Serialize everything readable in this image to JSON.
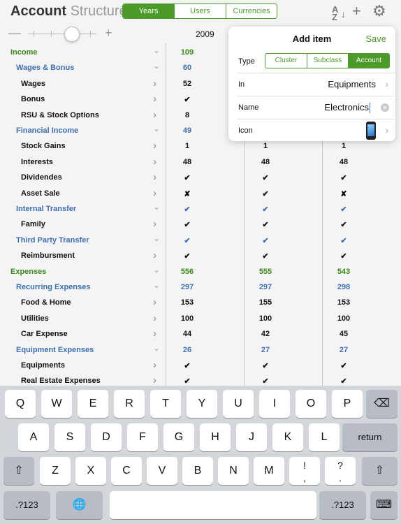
{
  "header": {
    "title_bold": "Account",
    "title_light": "Structure",
    "tabs": [
      "Years",
      "Users",
      "Currencies"
    ],
    "active_tab": "Years",
    "sort_icon": "sort-az-icon",
    "add_icon": "plus-icon",
    "settings_icon": "gear-icon"
  },
  "zoom": {
    "minus": "—",
    "plus": "+",
    "year": "2009"
  },
  "rows": [
    {
      "label": "Income",
      "level": "cat",
      "expand": "down",
      "v": [
        "109",
        "",
        ""
      ]
    },
    {
      "label": "Wages & Bonus",
      "level": "sub",
      "expand": "down",
      "v": [
        "60",
        "",
        ""
      ]
    },
    {
      "label": "Wages",
      "level": "item",
      "expand": "right",
      "v": [
        "52",
        "",
        ""
      ]
    },
    {
      "label": "Bonus",
      "level": "item",
      "expand": "right",
      "v": [
        "✔",
        "",
        ""
      ]
    },
    {
      "label": "RSU & Stock Options",
      "level": "item",
      "expand": "right",
      "v": [
        "8",
        "",
        ""
      ]
    },
    {
      "label": "Financial Income",
      "level": "sub",
      "expand": "down",
      "v": [
        "49",
        "",
        ""
      ]
    },
    {
      "label": "Stock Gains",
      "level": "item",
      "expand": "right",
      "v": [
        "1",
        "1",
        "1"
      ]
    },
    {
      "label": "Interests",
      "level": "item",
      "expand": "right",
      "v": [
        "48",
        "48",
        "48"
      ]
    },
    {
      "label": "Dividendes",
      "level": "item",
      "expand": "right",
      "v": [
        "✔",
        "✔",
        "✔"
      ]
    },
    {
      "label": "Asset Sale",
      "level": "item",
      "expand": "right",
      "v": [
        "✘",
        "✔",
        "✘"
      ]
    },
    {
      "label": "Internal Transfer",
      "level": "sub",
      "expand": "down",
      "v": [
        "✔",
        "✔",
        "✔"
      ]
    },
    {
      "label": "Family",
      "level": "item",
      "expand": "right",
      "v": [
        "✔",
        "✔",
        "✔"
      ]
    },
    {
      "label": "Third Party Transfer",
      "level": "sub",
      "expand": "down",
      "v": [
        "✔",
        "✔",
        "✔"
      ]
    },
    {
      "label": "Reimbursment",
      "level": "item",
      "expand": "right",
      "v": [
        "✔",
        "✔",
        "✔"
      ]
    },
    {
      "label": "Expenses",
      "level": "cat",
      "expand": "down",
      "v": [
        "556",
        "555",
        "543"
      ]
    },
    {
      "label": "Recurring Expenses",
      "level": "sub",
      "expand": "down",
      "v": [
        "297",
        "297",
        "298"
      ]
    },
    {
      "label": "Food & Home",
      "level": "item",
      "expand": "right",
      "v": [
        "153",
        "155",
        "153"
      ]
    },
    {
      "label": "Utilities",
      "level": "item",
      "expand": "right",
      "v": [
        "100",
        "100",
        "100"
      ]
    },
    {
      "label": "Car Expense",
      "level": "item",
      "expand": "right",
      "v": [
        "44",
        "42",
        "45"
      ]
    },
    {
      "label": "Equipment Expenses",
      "level": "sub",
      "expand": "down",
      "v": [
        "26",
        "27",
        "27"
      ]
    },
    {
      "label": "Equipments",
      "level": "item",
      "expand": "right",
      "v": [
        "✔",
        "✔",
        "✔"
      ]
    },
    {
      "label": "Real Estate Expenses",
      "level": "item",
      "expand": "right",
      "v": [
        "✔",
        "✔",
        "✔"
      ]
    }
  ],
  "popover": {
    "title": "Add item",
    "save": "Save",
    "type_label": "Type",
    "type_options": [
      "Cluster",
      "Subclass",
      "Account"
    ],
    "type_selected": "Account",
    "in_label": "In",
    "in_value": "Equipments",
    "name_label": "Name",
    "name_value": "Electronics",
    "icon_label": "Icon",
    "icon_value": "smartphone-icon"
  },
  "keyboard": {
    "row1": [
      "Q",
      "W",
      "E",
      "R",
      "T",
      "Y",
      "U",
      "I",
      "O",
      "P"
    ],
    "row2": [
      "A",
      "S",
      "D",
      "F",
      "G",
      "H",
      "J",
      "K",
      "L"
    ],
    "row3": [
      "Z",
      "X",
      "C",
      "V",
      "B",
      "N",
      "M"
    ],
    "return": "return",
    "numbers": ".?123",
    "backspace": "⌫",
    "shift": "⇧",
    "globe": "🌐",
    "dismiss": "⌨",
    "punct1_top": "!",
    "punct1_bottom": ",",
    "punct2_top": "?",
    "punct2_bottom": "."
  },
  "colors": {
    "accent_green": "#4c9a2a",
    "subclass_blue": "#3e6fb0",
    "cross_red": "#d21f1f"
  }
}
